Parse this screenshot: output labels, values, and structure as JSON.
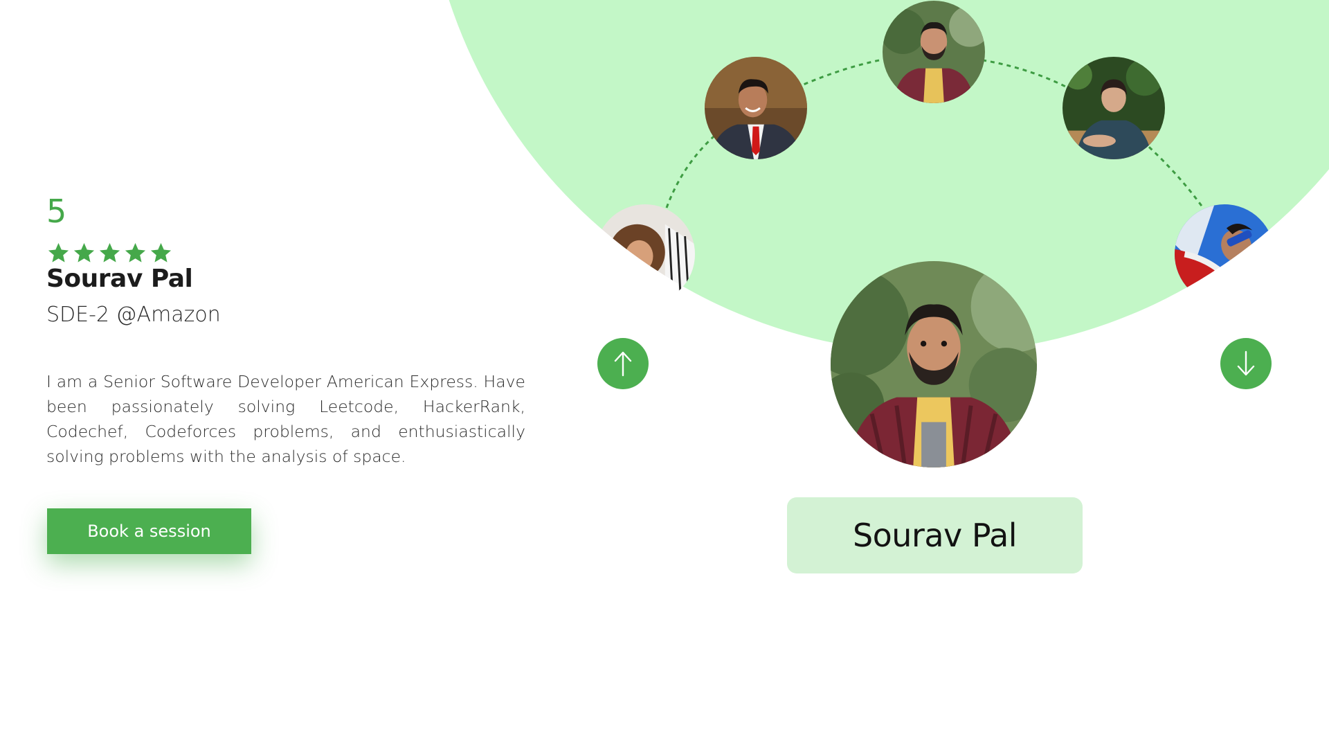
{
  "profile": {
    "rating": "5",
    "stars": 5,
    "name": "Sourav Pal",
    "role": "SDE-2 @Amazon",
    "bio": "I am a Senior Software Developer American Express. Have been passionately solving Leetcode, HackerRank, Codechef, Codeforces problems, and enthusiastically solving problems with the analysis of space.",
    "book_label": "Book a session"
  },
  "carousel": {
    "selected_name": "Sourav Pal",
    "up_icon": "arrow-up-icon",
    "down_icon": "arrow-down-icon"
  },
  "colors": {
    "accent": "#4caf50",
    "circle_bg": "#c3f7c7",
    "card_bg": "#d3f2d4"
  }
}
